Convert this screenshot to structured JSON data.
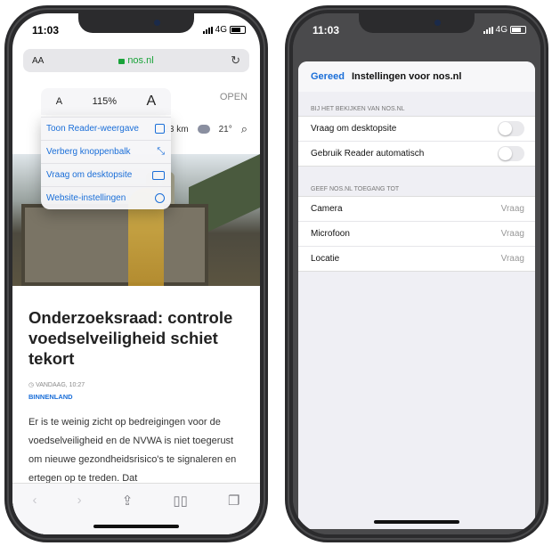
{
  "left_phone": {
    "status": {
      "time": "11:03",
      "network": "4G"
    },
    "urlbar": {
      "aa": "AA",
      "url": "nos.nl",
      "reload": "↻"
    },
    "zoom": {
      "small_a": "A",
      "percent": "115%",
      "big_a": "A"
    },
    "open_label": "OPEN",
    "weather": {
      "distance": "23 km",
      "temp": "21°"
    },
    "menu": [
      {
        "label": "Toon Reader-weergave",
        "icon": "reader-icon"
      },
      {
        "label": "Verberg knoppenbalk",
        "icon": "collapse-arrows-icon"
      },
      {
        "label": "Vraag om desktopsite",
        "icon": "desktop-icon"
      },
      {
        "label": "Website-instellingen",
        "icon": "settings-circle-icon"
      }
    ],
    "article": {
      "headline": "Onderzoeksraad: controle voedselveiligheid schiet tekort",
      "timestamp": "VANDAAG, 10:27",
      "category": "BINNENLAND",
      "body": "Er is te weinig zicht op bedreigingen voor de voedselveiligheid en de NVWA is niet toegerust om nieuwe gezondheidsrisico's te signaleren en ertegen op te treden. Dat"
    },
    "toolbar": [
      "back-icon",
      "forward-icon",
      "share-icon",
      "bookmarks-icon",
      "tabs-icon"
    ]
  },
  "right_phone": {
    "status": {
      "time": "11:03",
      "network": "4G"
    },
    "header": {
      "done": "Gereed",
      "title": "Instellingen voor nos.nl"
    },
    "section1": {
      "label": "BIJ HET BEKIJKEN VAN NOS.NL",
      "rows": [
        {
          "label": "Vraag om desktopsite",
          "on": false
        },
        {
          "label": "Gebruik Reader automatisch",
          "on": false
        }
      ]
    },
    "section2": {
      "label": "GEEF NOS.NL TOEGANG TOT",
      "rows": [
        {
          "label": "Camera",
          "value": "Vraag"
        },
        {
          "label": "Microfoon",
          "value": "Vraag"
        },
        {
          "label": "Locatie",
          "value": "Vraag"
        }
      ]
    }
  },
  "colors": {
    "accent": "#1a6ed8",
    "secure_green": "#1aa33a",
    "frame": "#2b2b2d"
  }
}
